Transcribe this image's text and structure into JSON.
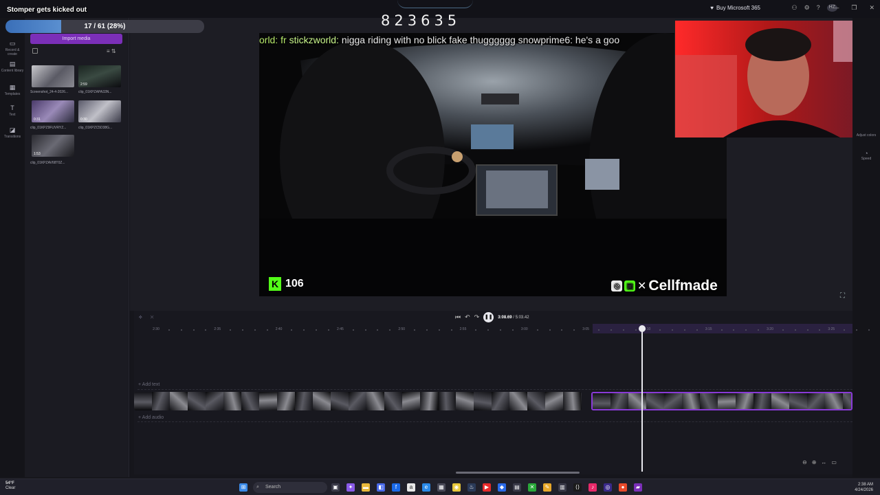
{
  "overlay": {
    "stream_title": "Stomper gets kicked out",
    "progress_label": "17 / 61 (28%)",
    "progress_fraction": 0.28,
    "counter": "823635"
  },
  "app": {
    "buy_ms": "Buy Microsoft 365",
    "avatar_initials": "HZ"
  },
  "nav": {
    "items": [
      {
        "label": "Record & create",
        "icon": "camera-icon"
      },
      {
        "label": "Content library",
        "icon": "library-icon"
      },
      {
        "label": "Templates",
        "icon": "templates-icon"
      },
      {
        "label": "Text",
        "icon": "text-icon"
      },
      {
        "label": "Transitions",
        "icon": "transitions-icon"
      }
    ]
  },
  "media": {
    "import_label": "Import media",
    "items": [
      {
        "name": "Screenshot_24-4-2026...",
        "duration": ""
      },
      {
        "name": "clip_01KPZAPA33N...",
        "duration": "2:59"
      },
      {
        "name": "clip_01KPZ9FUVRYZ...",
        "duration": "0:31"
      },
      {
        "name": "clip_01KPZC5D38G...",
        "duration": "0:30"
      },
      {
        "name": "clip_01KPZAV68T0Z...",
        "duration": "1:53"
      }
    ]
  },
  "preview": {
    "chat": {
      "prefix": "orld: fr ",
      "user1": "stickzworld:",
      "msg1": " nigga riding with no blick fake thugggggg ",
      "user2": "snowprime6:",
      "msg2": " he's a goo"
    },
    "kick_count": "106",
    "kick_logo": "K",
    "watermark": "Cellfmade"
  },
  "right_rail": {
    "items": [
      {
        "label": "Adjust colors"
      },
      {
        "label": "Speed"
      }
    ]
  },
  "playback": {
    "current_time": "3:08.69",
    "total_time": "/ 5:03.42"
  },
  "ruler": {
    "labels": [
      "2:30",
      "2:35",
      "2:40",
      "2:45",
      "2:50",
      "2:55",
      "3:00",
      "3:05",
      "3:10",
      "3:15",
      "3:20",
      "3:25"
    ]
  },
  "tracks": {
    "add_text": "+ Add text",
    "add_audio": "+ Add audio"
  },
  "taskbar": {
    "weather_temp": "54°F",
    "weather_desc": "Clear",
    "search": "Search",
    "time": "2:38 AM",
    "date": "4/24/2026"
  },
  "colors": {
    "accent": "#7b2fb8",
    "selection": "#8a3ad8",
    "kick_green": "#53fc18"
  }
}
